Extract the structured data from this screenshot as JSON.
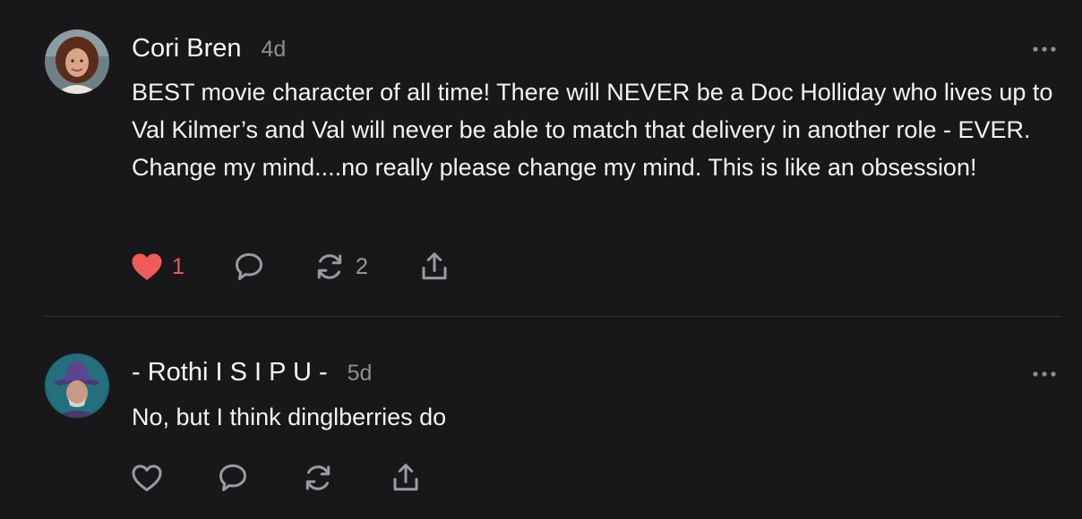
{
  "colors": {
    "background": "#18181a",
    "text": "#f3f3f3",
    "muted": "#8e8e93",
    "like_active": "#f05a5b",
    "icon": "#9a9aa0",
    "divider": "#333336"
  },
  "comments": [
    {
      "author": "Cori Bren",
      "time": "4d",
      "text": "BEST movie character of all time! There will NEVER be a Doc Holliday who lives up to Val Kilmer’s and Val will never be able to match that delivery in another role - EVER. Change my mind....no really please change my mind. This is like an obsession!",
      "liked": true,
      "like_count": "1",
      "restack_count": "2",
      "icons": [
        "heart-filled-icon",
        "comment-icon",
        "restack-icon",
        "share-icon",
        "more-icon"
      ]
    },
    {
      "author": "- Rothi I S I P U -",
      "time": "5d",
      "text": "No, but I think dinglberries do",
      "liked": false,
      "like_count": "",
      "restack_count": "",
      "icons": [
        "heart-outline-icon",
        "comment-icon",
        "restack-icon",
        "share-icon",
        "more-icon"
      ]
    }
  ]
}
